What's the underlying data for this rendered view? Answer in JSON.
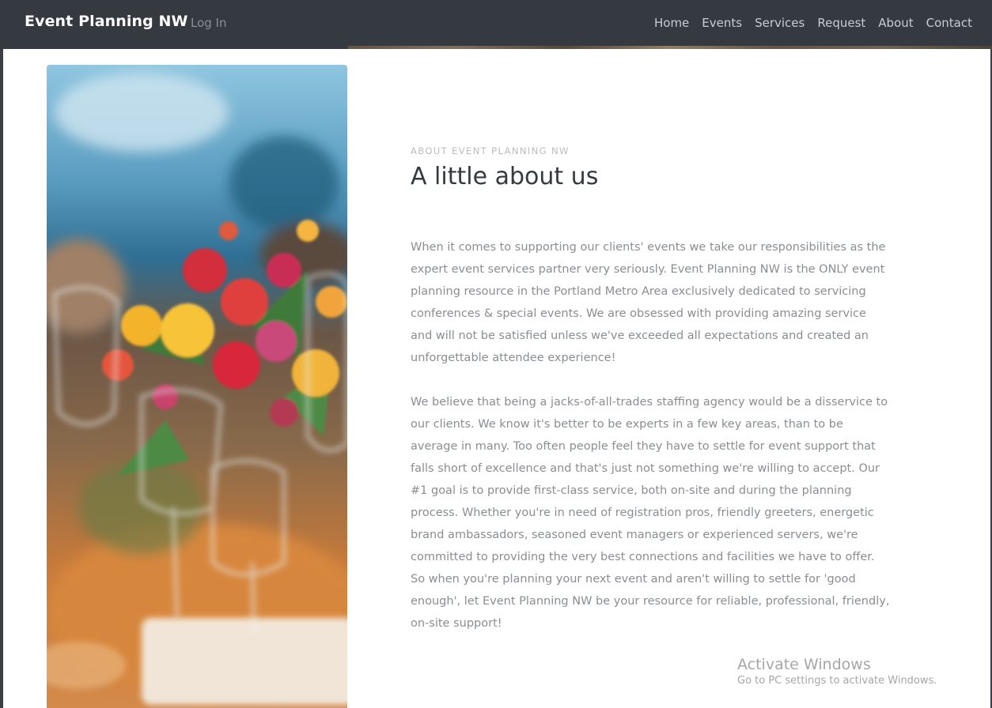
{
  "navbar": {
    "brand": "Event Planning NW",
    "login": "Log In",
    "links": [
      "Home",
      "Events",
      "Services",
      "Request",
      "About",
      "Contact"
    ]
  },
  "about": {
    "eyebrow": "ABOUT EVENT PLANNING NW",
    "heading": "A little about us",
    "paragraphs": [
      "When it comes to supporting our clients' events we take our responsibilities as the expert event services partner very seriously. Event Planning NW is the ONLY event planning resource in the Portland Metro Area exclusively dedicated to servicing conferences & special events. We are obsessed with providing amazing service and will not be satisfied unless we've exceeded all expectations and created an unforgettable attendee experience!",
      "We believe that being a jacks-of-all-trades staffing agency would be a disservice to our clients. We know it's better to be experts in a few key areas, than to be average in many. Too often people feel they have to settle for event support that falls short of excellence and that's just not something we're willing to accept. Our #1 goal is to provide first-class service, both on-site and during the planning process. Whether you're in need of registration pros, friendly greeters, energetic brand ambassadors, seasoned event managers or experienced servers, we're committed to providing the very best connections and facilities we have to offer. So when you're planning your next event and aren't willing to settle for 'good enough', let Event Planning NW be your resource for reliable, professional, friendly, on-site support!"
    ]
  },
  "watermark": {
    "title": "Activate Windows",
    "subtitle": "Go to PC settings to activate Windows."
  },
  "colors": {
    "navbar_bg": "#343a40",
    "brand_text": "#ffffff",
    "body_text": "#8a8d91",
    "heading_text": "#343a40"
  }
}
